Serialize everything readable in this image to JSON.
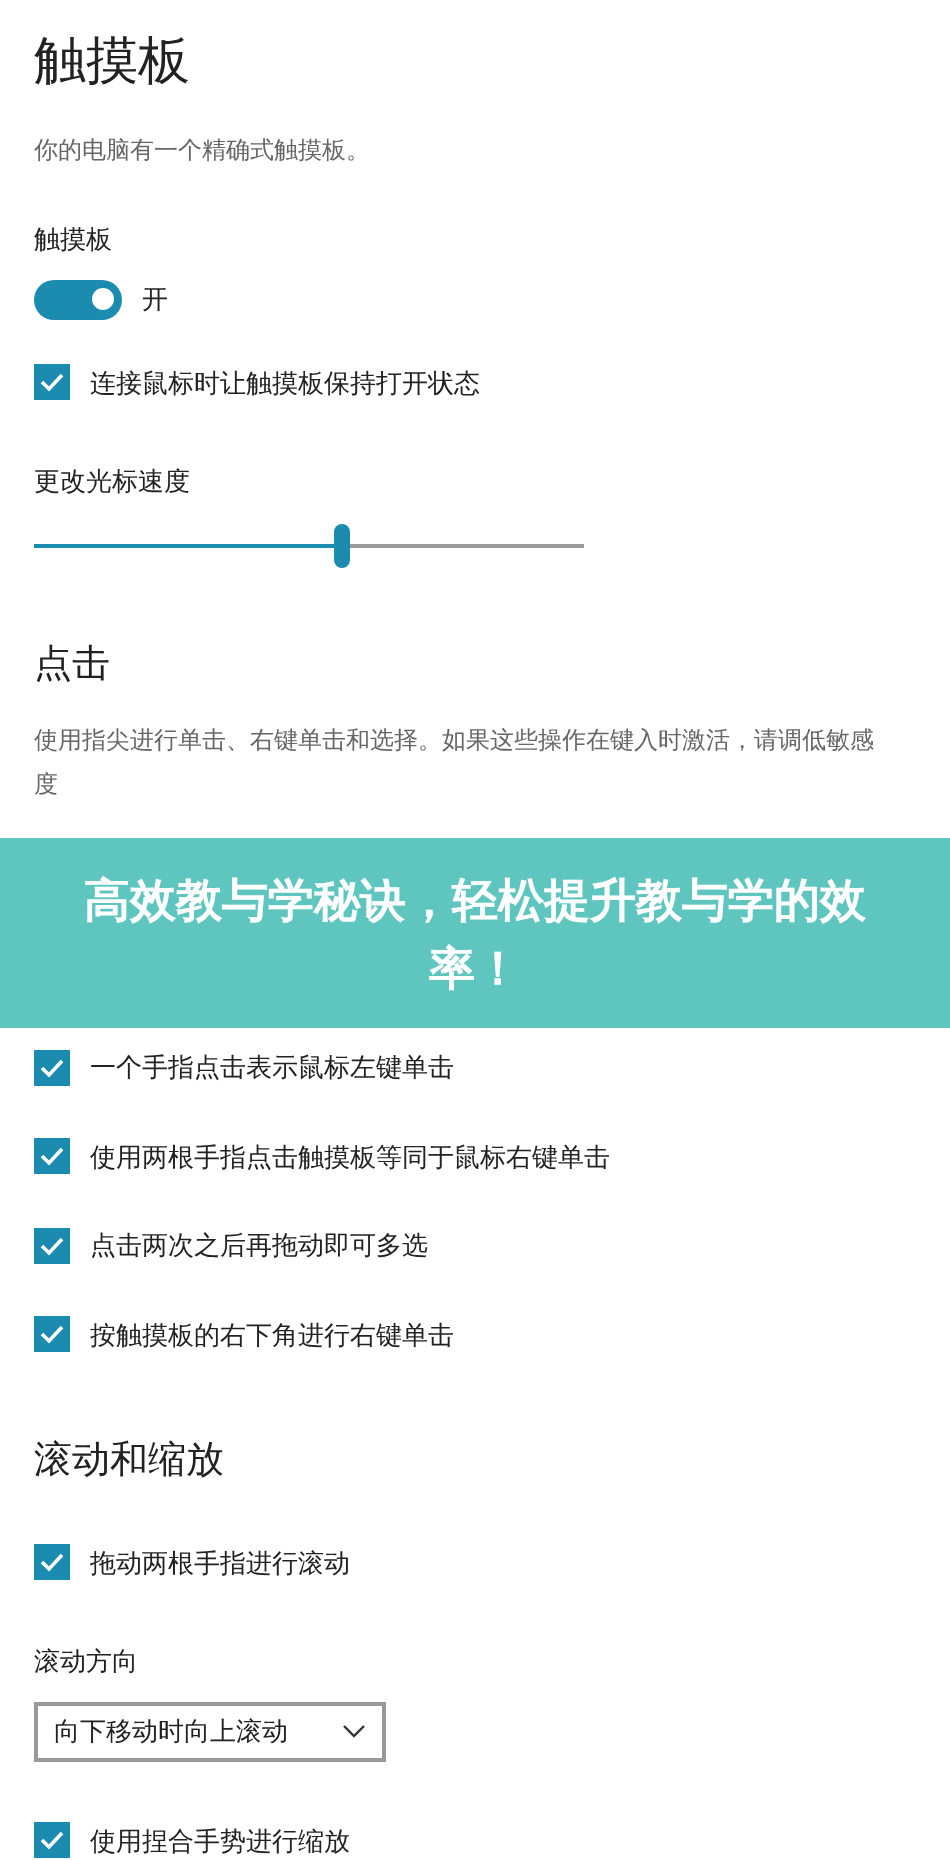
{
  "title": "触摸板",
  "subtitle": "你的电脑有一个精确式触摸板。",
  "touchpad": {
    "label": "触摸板",
    "on": true,
    "state_text": "开"
  },
  "keep_on": {
    "label": "连接鼠标时让触摸板保持打开状态",
    "checked": true
  },
  "cursor_speed": {
    "label": "更改光标速度",
    "level": 0.56
  },
  "taps": {
    "heading": "点击",
    "description": "使用指尖进行单击、右键单击和选择。如果这些操作在键入时激活，请调低敏感度",
    "banner": "高效教与学秘诀，轻松提升教与学的效率！",
    "options": [
      {
        "label": "一个手指点击表示鼠标左键单击",
        "checked": true
      },
      {
        "label": "使用两根手指点击触摸板等同于鼠标右键单击",
        "checked": true
      },
      {
        "label": "点击两次之后再拖动即可多选",
        "checked": true
      },
      {
        "label": "按触摸板的右下角进行右键单击",
        "checked": true
      }
    ]
  },
  "scroll_zoom": {
    "heading": "滚动和缩放",
    "drag_scroll": {
      "label": "拖动两根手指进行滚动",
      "checked": true
    },
    "direction_label": "滚动方向",
    "direction_value": "向下移动时向上滚动",
    "pinch": {
      "label": "使用捏合手势进行缩放",
      "checked": true
    }
  }
}
